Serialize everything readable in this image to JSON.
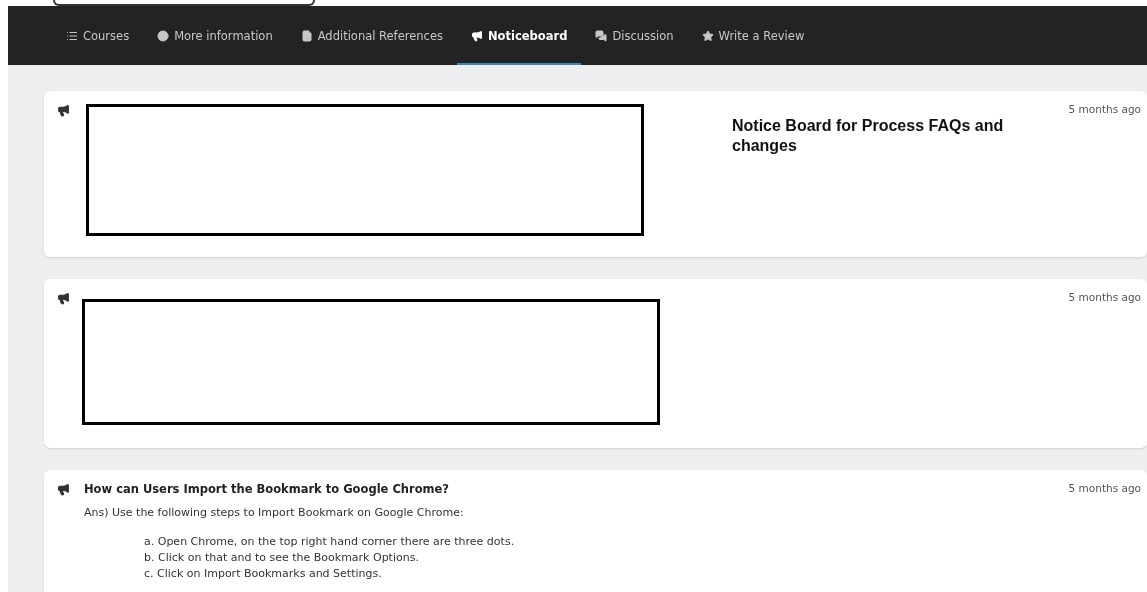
{
  "nav": {
    "tabs": [
      {
        "label": "Courses",
        "selected": false
      },
      {
        "label": "More information",
        "selected": false
      },
      {
        "label": "Additional References",
        "selected": false
      },
      {
        "label": "Noticeboard",
        "selected": true
      },
      {
        "label": "Discussion",
        "selected": false
      },
      {
        "label": "Write a Review",
        "selected": false
      }
    ]
  },
  "notices": [
    {
      "redacted": true,
      "heading": "Notice Board for Process FAQs and changes",
      "time": "5 months ago"
    },
    {
      "redacted": true,
      "time": "5 months ago"
    },
    {
      "redacted": false,
      "title": "How can Users Import the Bookmark to Google Chrome?",
      "time": "5 months ago",
      "answer": "Ans) Use the following steps to Import Bookmark on Google Chrome:",
      "steps": [
        "a. Open Chrome, on the top right hand corner there are three dots.",
        "b. Click on that and to see the Bookmark Options.",
        "c. Click on Import Bookmarks and Settings."
      ]
    }
  ]
}
